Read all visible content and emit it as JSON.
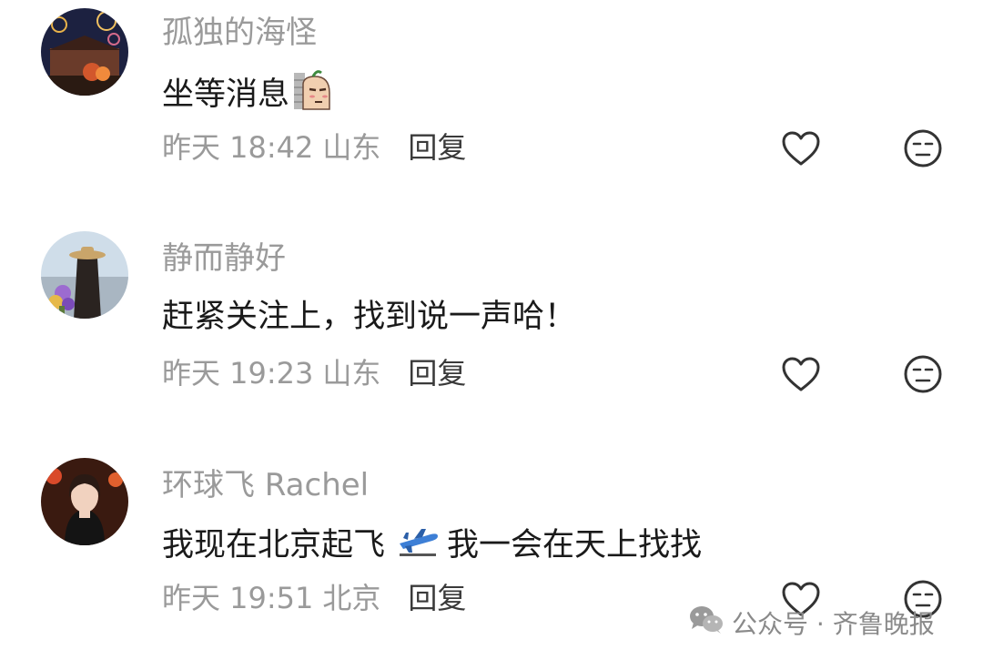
{
  "comments": [
    {
      "username": "孤独的海怪",
      "text": "坐等消息",
      "emoji": "sticker-emoji",
      "time": "昨天 18:42",
      "location": "山东",
      "reply_label": "回复"
    },
    {
      "username": "静而静好",
      "text": "赶紧关注上，找到说一声哈！",
      "time": "昨天 19:23",
      "location": "山东",
      "reply_label": "回复"
    },
    {
      "username": "环球飞 Rachel",
      "text_before": "我现在北京起飞",
      "emoji": "airplane-emoji",
      "text_after": "我一会在天上找找",
      "time": "昨天 19:51",
      "location": "北京",
      "reply_label": "回复"
    }
  ],
  "watermark": {
    "icon": "wechat-icon",
    "text": "公众号 · 齐鲁晚报"
  }
}
